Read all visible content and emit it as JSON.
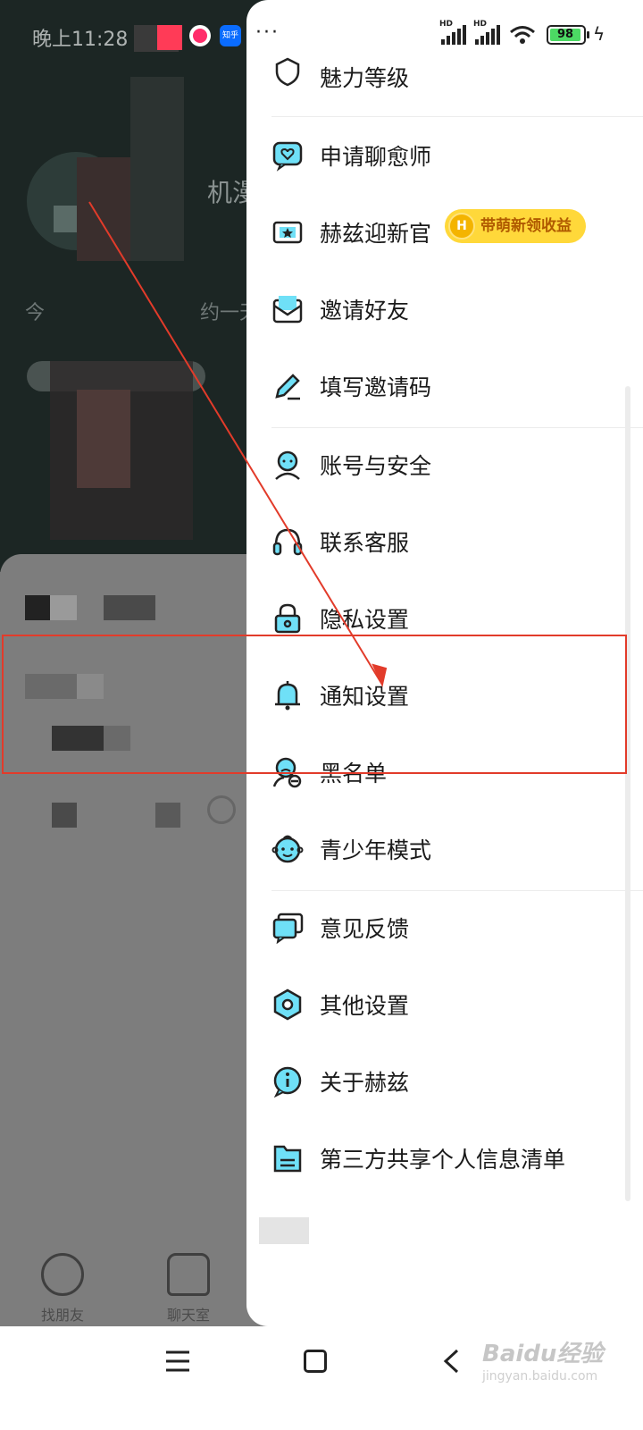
{
  "status_bar": {
    "time": "晚上11:28",
    "more": "···",
    "sim1_label": "HD",
    "sim2_label": "HD",
    "battery_level": "98"
  },
  "background": {
    "name_fragment": "机漫",
    "line_left": "今",
    "line_right": "约一天"
  },
  "menu": {
    "items": [
      {
        "label": "魅力等级",
        "icon": "shield-icon"
      },
      {
        "label": "申请聊愈师",
        "icon": "heart-chat-icon"
      },
      {
        "label": "赫兹迎新官",
        "icon": "star-card-icon",
        "badge": "带萌新领收益"
      },
      {
        "label": "邀请好友",
        "icon": "envelope-icon"
      },
      {
        "label": "填写邀请码",
        "icon": "pencil-icon"
      },
      {
        "label": "账号与安全",
        "icon": "person-icon"
      },
      {
        "label": "联系客服",
        "icon": "headset-icon"
      },
      {
        "label": "隐私设置",
        "icon": "lock-icon"
      },
      {
        "label": "通知设置",
        "icon": "bell-icon"
      },
      {
        "label": "黑名单",
        "icon": "block-user-icon"
      },
      {
        "label": "青少年模式",
        "icon": "child-face-icon"
      },
      {
        "label": "意见反馈",
        "icon": "feedback-icon"
      },
      {
        "label": "其他设置",
        "icon": "hexagon-icon"
      },
      {
        "label": "关于赫兹",
        "icon": "info-icon"
      },
      {
        "label": "第三方共享个人信息清单",
        "icon": "document-icon"
      }
    ]
  },
  "bottom_tabs": [
    {
      "label": "找朋友",
      "icon": "moon-icon"
    },
    {
      "label": "聊天室",
      "icon": "house-icon"
    }
  ],
  "watermark": {
    "brand": "Baidu经验",
    "url": "jingyan.baidu.com"
  },
  "colors": {
    "accent_icon": "#3fd0f0",
    "annotation": "#e23b2a",
    "badge": "#ffd83a"
  }
}
